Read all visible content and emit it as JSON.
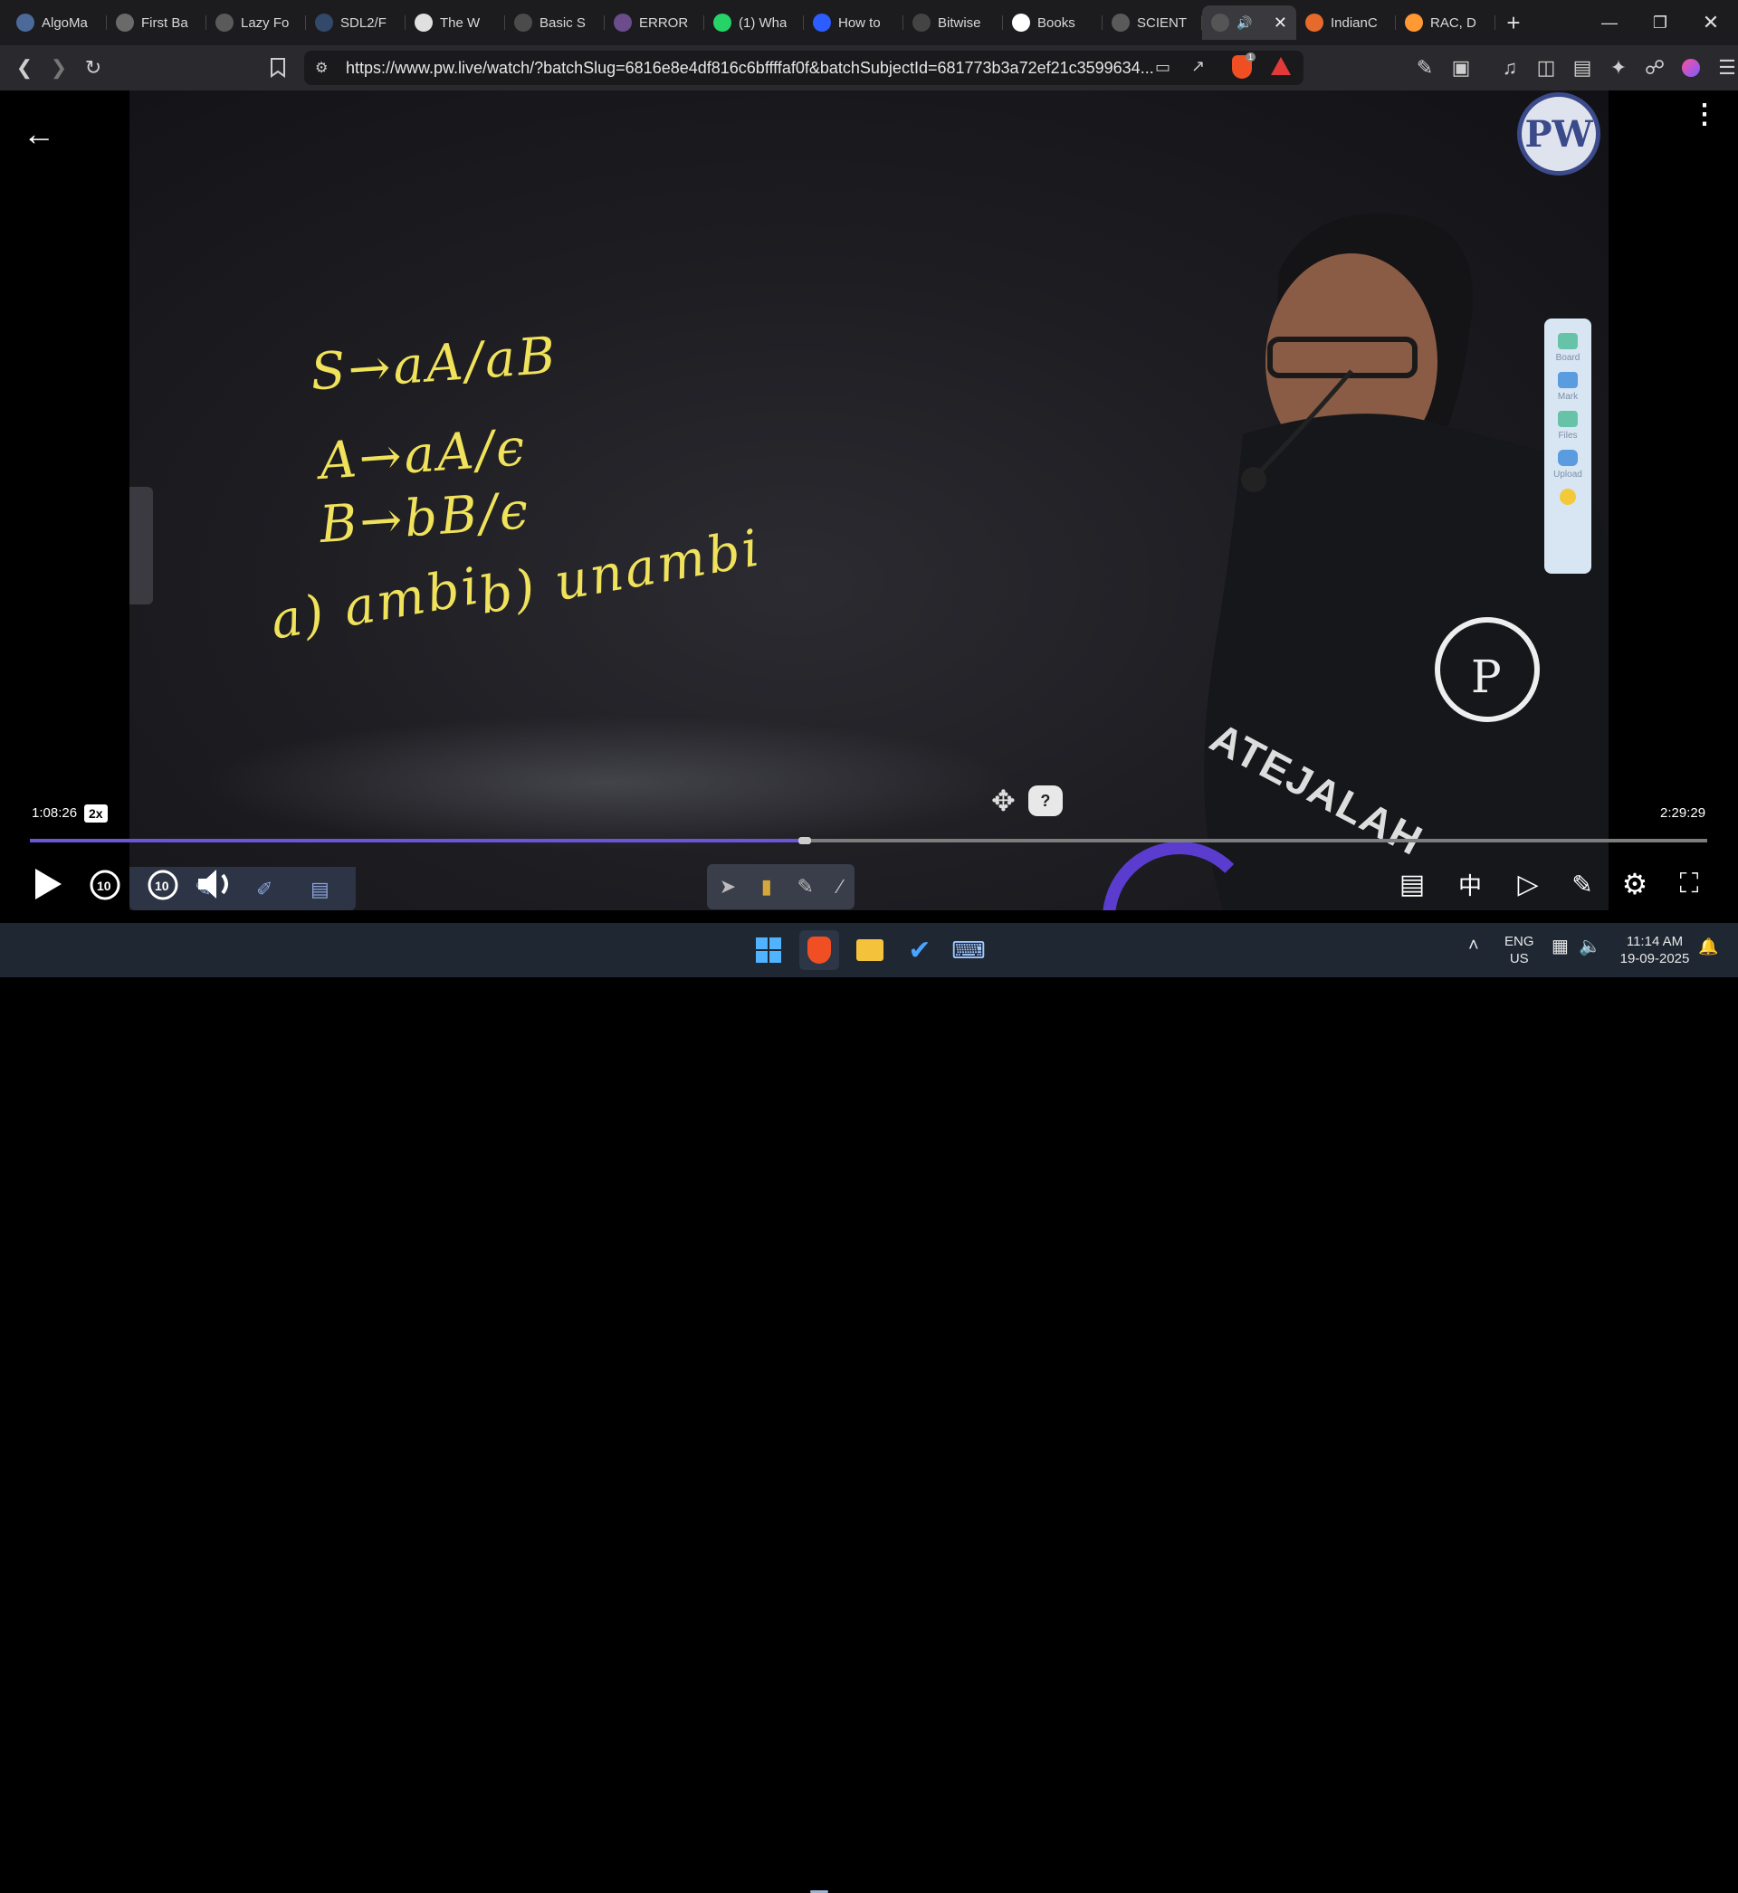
{
  "browser": {
    "tabs": [
      {
        "label": "AlgoMa",
        "icon": "algomaster-icon",
        "color": "#4b6a9a"
      },
      {
        "label": "First Ba",
        "icon": "coin-icon",
        "color": "#6a6a6a"
      },
      {
        "label": "Lazy Fo",
        "icon": "globe-icon",
        "color": "#5a5a5a"
      },
      {
        "label": "SDL2/F",
        "icon": "sdl-icon",
        "color": "#33496a"
      },
      {
        "label": "The W",
        "icon": "wiki-icon",
        "color": "#e0e0e0"
      },
      {
        "label": "Basic S",
        "icon": "doc-icon",
        "color": "#4b4b4b"
      },
      {
        "label": "ERROR",
        "icon": "error-icon",
        "color": "#6a4d8a"
      },
      {
        "label": "(1) Wha",
        "icon": "whatsapp-icon",
        "color": "#25d366"
      },
      {
        "label": "How to",
        "icon": "bookmark-blue-icon",
        "color": "#2d5cff"
      },
      {
        "label": "Bitwise",
        "icon": "bitwise-icon",
        "color": "#444444"
      },
      {
        "label": "Books",
        "icon": "google-icon",
        "color": "#ffffff"
      },
      {
        "label": "SCIENT",
        "icon": "globe-icon",
        "color": "#5a5a5a"
      },
      {
        "label": "",
        "icon": "audio-playing-icon",
        "color": "#555555",
        "active": true
      },
      {
        "label": "IndianC",
        "icon": "pizza-icon",
        "color": "#e66a2c"
      },
      {
        "label": "RAC, D",
        "icon": "india-flag-icon",
        "color": "#ff9933"
      }
    ],
    "new_tab": "+",
    "url": "https://www.pw.live/watch/?batchSlug=6816e8e4df816c6bffffaf0f&batchSubjectId=681773b3a72ef21c3599634...",
    "shield_badge": "1"
  },
  "player": {
    "board_lines": [
      "S→aA/aB",
      "A→aA/ϵ",
      "B→bB/ϵ",
      "a) ambi",
      "b) unambi"
    ],
    "current_time": "1:08:26",
    "speed": "2x",
    "duration": "2:29:29",
    "progress_fraction": 0.4617,
    "brand_logo": "PW",
    "side_panel": [
      "Board",
      "Mark",
      "Files",
      "Upload"
    ],
    "shirt_text": "ATEJALAH"
  },
  "taskbar": {
    "lang_top": "ENG",
    "lang_bottom": "US",
    "time": "11:14 AM",
    "date": "19-09-2025"
  }
}
